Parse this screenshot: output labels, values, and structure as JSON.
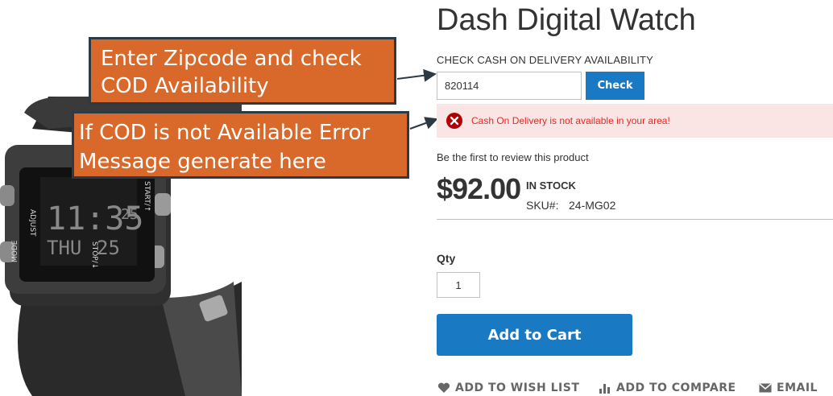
{
  "product": {
    "title": "Dash Digital Watch",
    "price": "$92.00",
    "stock": "IN STOCK",
    "sku_label": "SKU#:",
    "sku_value": "24-MG02",
    "review_text": "Be the first to review this product",
    "watch_face": {
      "left_top": "ADJUST",
      "left_bottom": "MODE",
      "right_top": "START/↑",
      "right_bottom": "STOP/↓",
      "time": "11:35",
      "seconds": "25",
      "day": "THU",
      "date": "25"
    }
  },
  "cod": {
    "label": "CHECK CASH ON DELIVERY AVAILABILITY",
    "zip_value": "820114",
    "check_label": "Check",
    "error_message": "Cash On Delivery is not available in your area!"
  },
  "qty": {
    "label": "Qty",
    "value": "1"
  },
  "cart": {
    "add_label": "Add to Cart"
  },
  "actions": {
    "wishlist": "ADD TO WISH LIST",
    "compare": "ADD TO COMPARE",
    "email": "EMAIL"
  },
  "annotations": {
    "zip_line1": "Enter Zipcode and check",
    "zip_line2": "COD Availability",
    "error_line1": "If COD is not Available Error",
    "error_line2": "Message generate here"
  },
  "colors": {
    "primary": "#1979c3",
    "error_text": "#e02b27",
    "error_bg": "#fae5e5",
    "annotation_bg": "#d8692a"
  }
}
